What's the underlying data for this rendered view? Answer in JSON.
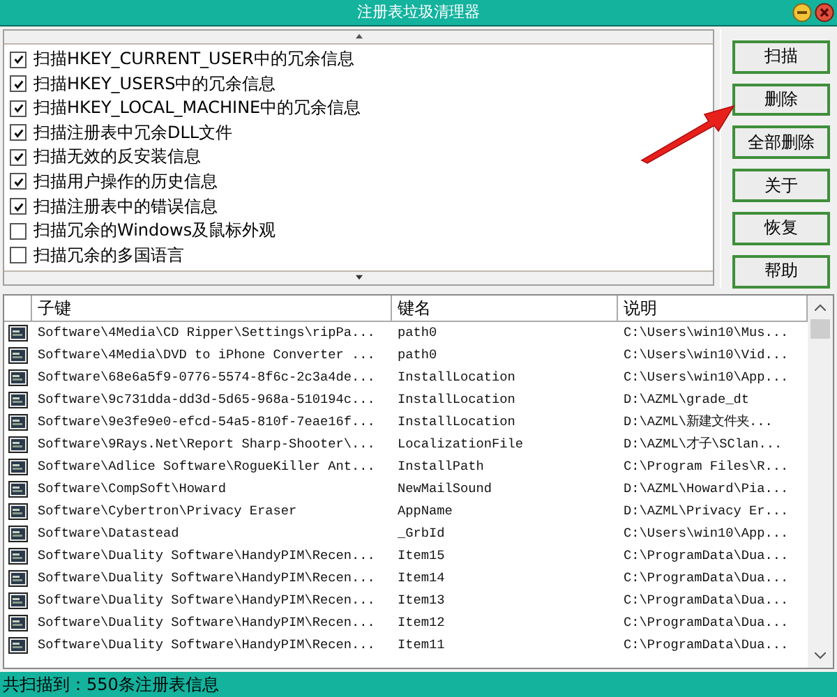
{
  "window": {
    "title": "注册表垃圾清理器"
  },
  "options": [
    {
      "label": "扫描HKEY_CURRENT_USER中的冗余信息",
      "checked": true
    },
    {
      "label": "扫描HKEY_USERS中的冗余信息",
      "checked": true
    },
    {
      "label": "扫描HKEY_LOCAL_MACHINE中的冗余信息",
      "checked": true
    },
    {
      "label": "扫描注册表中冗余DLL文件",
      "checked": true
    },
    {
      "label": "扫描无效的反安装信息",
      "checked": true
    },
    {
      "label": "扫描用户操作的历史信息",
      "checked": true
    },
    {
      "label": "扫描注册表中的错误信息",
      "checked": true
    },
    {
      "label": "扫描冗余的Windows及鼠标外观",
      "checked": false
    },
    {
      "label": "扫描冗余的多国语言",
      "checked": false
    }
  ],
  "buttons": [
    "扫描",
    "删除",
    "全部删除",
    "关于",
    "恢复",
    "帮助"
  ],
  "table": {
    "columns": [
      "子键",
      "键名",
      "说明"
    ],
    "rows": [
      [
        "Software\\4Media\\CD Ripper\\Settings\\ripPa...",
        "path0",
        "C:\\Users\\win10\\Mus..."
      ],
      [
        "Software\\4Media\\DVD to iPhone Converter ...",
        "path0",
        "C:\\Users\\win10\\Vid..."
      ],
      [
        "Software\\68e6a5f9-0776-5574-8f6c-2c3a4de...",
        "InstallLocation",
        "C:\\Users\\win10\\App..."
      ],
      [
        "Software\\9c731dda-dd3d-5d65-968a-510194c...",
        "InstallLocation",
        "D:\\AZML\\grade_dt"
      ],
      [
        "Software\\9e3fe9e0-efcd-54a5-810f-7eae16f...",
        "InstallLocation",
        "D:\\AZML\\新建文件夹..."
      ],
      [
        "Software\\9Rays.Net\\Report Sharp-Shooter\\...",
        "LocalizationFile",
        "D:\\AZML\\才子\\SClan..."
      ],
      [
        "Software\\Adlice Software\\RogueKiller Ant...",
        "InstallPath",
        "C:\\Program Files\\R..."
      ],
      [
        "Software\\CompSoft\\Howard",
        "NewMailSound",
        "D:\\AZML\\Howard\\Pia..."
      ],
      [
        "Software\\Cybertron\\Privacy Eraser",
        "AppName",
        "D:\\AZML\\Privacy Er..."
      ],
      [
        "Software\\Datastead",
        "_GrbId",
        "C:\\Users\\win10\\App..."
      ],
      [
        "Software\\Duality Software\\HandyPIM\\Recen...",
        "Item15",
        "C:\\ProgramData\\Dua..."
      ],
      [
        "Software\\Duality Software\\HandyPIM\\Recen...",
        "Item14",
        "C:\\ProgramData\\Dua..."
      ],
      [
        "Software\\Duality Software\\HandyPIM\\Recen...",
        "Item13",
        "C:\\ProgramData\\Dua..."
      ],
      [
        "Software\\Duality Software\\HandyPIM\\Recen...",
        "Item12",
        "C:\\ProgramData\\Dua..."
      ],
      [
        "Software\\Duality Software\\HandyPIM\\Recen...",
        "Item11",
        "C:\\ProgramData\\Dua..."
      ]
    ]
  },
  "status_bar": "共扫描到：550条注册表信息"
}
